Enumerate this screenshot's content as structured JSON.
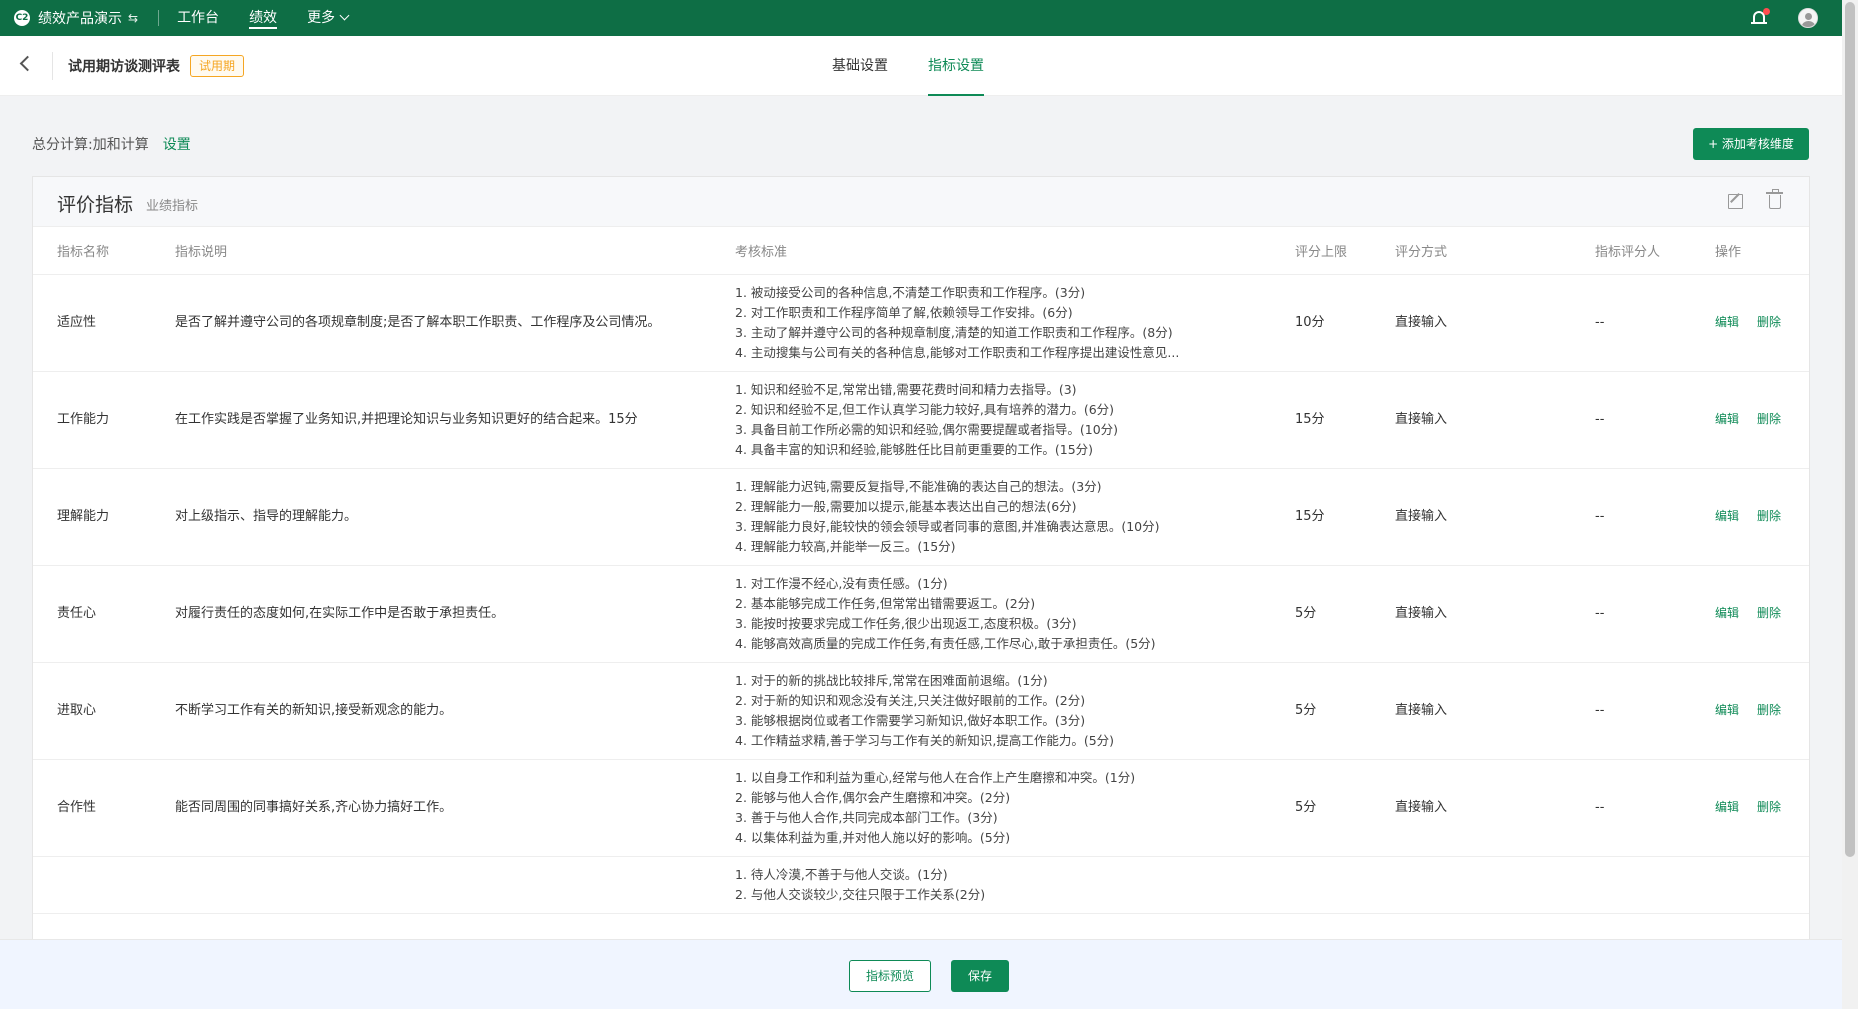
{
  "topbar": {
    "brand": "绩效产品演示",
    "brand_logo": "C2",
    "nav": [
      "工作台",
      "绩效",
      "更多"
    ],
    "active_nav": "绩效"
  },
  "subheader": {
    "title": "试用期访谈测评表",
    "tag": "试用期",
    "tabs": [
      "基础设置",
      "指标设置"
    ],
    "active_tab": "指标设置"
  },
  "total": {
    "label": "总分计算:加和计算",
    "link": "设置"
  },
  "add_button": "+ 添加考核维度",
  "card": {
    "title": "评价指标",
    "subtitle": "业绩指标",
    "columns": [
      "指标名称",
      "指标说明",
      "考核标准",
      "评分上限",
      "评分方式",
      "指标评分人",
      "操作"
    ],
    "rows": [
      {
        "name": "适应性",
        "desc": "是否了解并遵守公司的各项规章制度;是否了解本职工作职责、工作程序及公司情况。",
        "criteria": [
          "1. 被动接受公司的各种信息,不清楚工作职责和工作程序。(3分)",
          "2. 对工作职责和工作程序简单了解,依赖领导工作安排。(6分)",
          "3. 主动了解并遵守公司的各种规章制度,清楚的知道工作职责和工作程序。(8分)",
          "4. 主动搜集与公司有关的各种信息,能够对工作职责和工作程序提出建设性意见..."
        ],
        "max": "10分",
        "method": "直接输入",
        "scorer": "--"
      },
      {
        "name": "工作能力",
        "desc": "在工作实践是否掌握了业务知识,并把理论知识与业务知识更好的结合起来。15分",
        "criteria": [
          "1. 知识和经验不足,常常出错,需要花费时间和精力去指导。(3)",
          "2. 知识和经验不足,但工作认真学习能力较好,具有培养的潜力。(6分)",
          "3. 具备目前工作所必需的知识和经验,偶尔需要提醒或者指导。(10分)",
          "4. 具备丰富的知识和经验,能够胜任比目前更重要的工作。(15分)"
        ],
        "max": "15分",
        "method": "直接输入",
        "scorer": "--"
      },
      {
        "name": "理解能力",
        "desc": "对上级指示、指导的理解能力。",
        "criteria": [
          "1. 理解能力迟钝,需要反复指导,不能准确的表达自己的想法。(3分)",
          "2. 理解能力一般,需要加以提示,能基本表达出自己的想法(6分)",
          "3. 理解能力良好,能较快的领会领导或者同事的意图,并准确表达意思。(10分)",
          "4. 理解能力较高,并能举一反三。(15分)"
        ],
        "max": "15分",
        "method": "直接输入",
        "scorer": "--"
      },
      {
        "name": "责任心",
        "desc": "对履行责任的态度如何,在实际工作中是否敢于承担责任。",
        "criteria": [
          "1. 对工作漫不经心,没有责任感。(1分)",
          "2. 基本能够完成工作任务,但常常出错需要返工。(2分)",
          "3. 能按时按要求完成工作任务,很少出现返工,态度积极。(3分)",
          "4. 能够高效高质量的完成工作任务,有责任感,工作尽心,敢于承担责任。(5分)"
        ],
        "max": "5分",
        "method": "直接输入",
        "scorer": "--"
      },
      {
        "name": "进取心",
        "desc": "不断学习工作有关的新知识,接受新观念的能力。",
        "criteria": [
          "1. 对于的新的挑战比较排斥,常常在困难面前退缩。(1分)",
          "2. 对于新的知识和观念没有关注,只关注做好眼前的工作。(2分)",
          "3. 能够根据岗位或者工作需要学习新知识,做好本职工作。(3分)",
          "4. 工作精益求精,善于学习与工作有关的新知识,提高工作能力。(5分)"
        ],
        "max": "5分",
        "method": "直接输入",
        "scorer": "--"
      },
      {
        "name": "合作性",
        "desc": "能否同周围的同事搞好关系,齐心协力搞好工作。",
        "criteria": [
          "1. 以自身工作和利益为重心,经常与他人在合作上产生磨擦和冲突。(1分)",
          "2. 能够与他人合作,偶尔会产生磨擦和冲突。(2分)",
          "3. 善于与他人合作,共同完成本部门工作。(3分)",
          "4. 以集体利益为重,并对他人施以好的影响。(5分)"
        ],
        "max": "5分",
        "method": "直接输入",
        "scorer": "--"
      },
      {
        "name": "",
        "desc": "",
        "criteria": [
          "1. 待人冷漠,不善于与他人交谈。(1分)",
          "2. 与他人交谈较少,交往只限于工作关系(2分)"
        ],
        "max": "",
        "method": "",
        "scorer": ""
      }
    ],
    "op_edit": "编辑",
    "op_delete": "删除"
  },
  "bottom": {
    "preview": "指标预览",
    "save": "保存"
  },
  "colors": {
    "topbar": "#0e6e45",
    "primary": "#0e8a56",
    "tag": "#f5a623"
  }
}
